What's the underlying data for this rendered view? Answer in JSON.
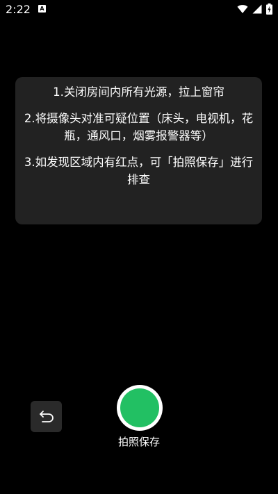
{
  "status_bar": {
    "time": "2:22",
    "app_icon_glyph": "A"
  },
  "tips": [
    "1.关闭房间内所有光源，拉上窗帘",
    "2.将摄像头对准可疑位置（床头，电视机，花瓶，通风口，烟雾报警器等）",
    "3.如发现区域内有红点，可「拍照保存」进行排查"
  ],
  "capture": {
    "label": "拍照保存"
  },
  "icons": {
    "undo": "undo-icon",
    "wifi": "wifi-icon",
    "signal": "signal-icon",
    "battery": "battery-charging-icon"
  },
  "colors": {
    "background": "#000000",
    "card": "#222222",
    "shutter_ring": "#ffffff",
    "shutter_fill": "#22c063"
  }
}
